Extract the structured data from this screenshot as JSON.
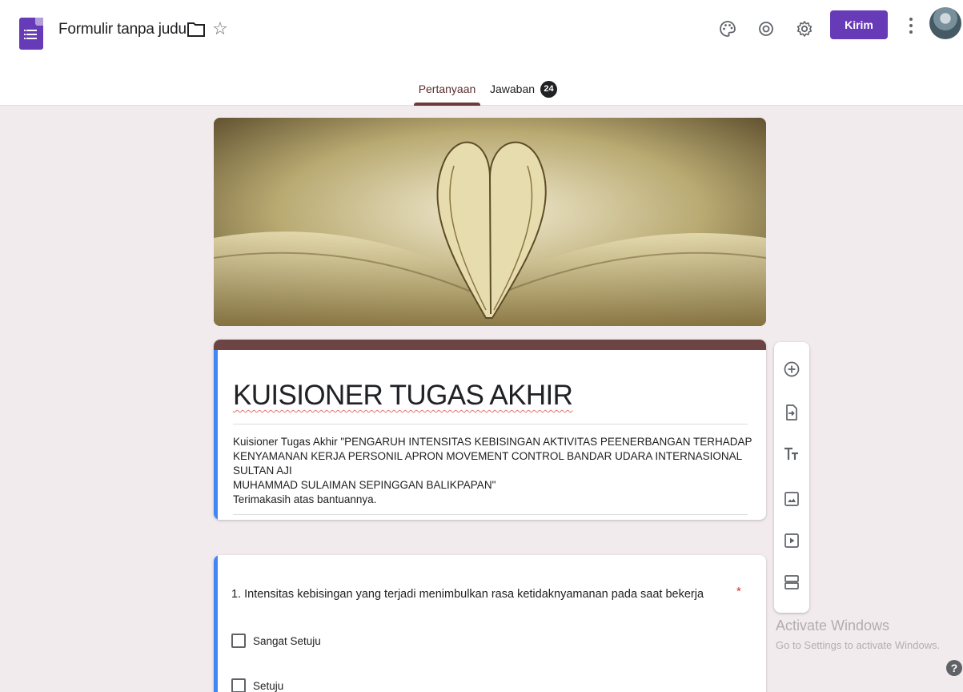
{
  "header": {
    "doc_title": "Formulir tanpa judul",
    "send_label": "Kirim"
  },
  "tabs": {
    "questions_label": "Pertanyaan",
    "responses_label": "Jawaban",
    "responses_count": "24"
  },
  "form": {
    "title": "KUISIONER TUGAS AKHIR",
    "description_line1": "Kuisioner Tugas Akhir \"PENGARUH INTENSITAS KEBISINGAN AKTIVITAS PEENERBANGAN TERHADAP",
    "description_line2": "KENYAMANAN KERJA PERSONIL APRON MOVEMENT CONTROL BANDAR UDARA INTERNASIONAL SULTAN AJI",
    "description_line3": "MUHAMMAD SULAIMAN SEPINGGAN BALIKPAPAN\"",
    "description_line4": "Terimakasih atas bantuannya."
  },
  "question": {
    "text": "1. Intensitas kebisingan yang terjadi menimbulkan rasa ketidaknyamanan pada saat bekerja",
    "required_mark": "*",
    "options": [
      "Sangat Setuju",
      "Setuju"
    ]
  },
  "watermark": {
    "line1": "Activate Windows",
    "line2": "Go to Settings to activate Windows."
  },
  "help_label": "?",
  "colors": {
    "brand": "#673ab7",
    "theme": "#6d4444",
    "accent_bar": "#4285f4",
    "page_bg": "#f1ebee"
  },
  "icons": [
    "forms-app-icon",
    "folder-icon",
    "star-icon",
    "palette-icon",
    "eye-icon",
    "gear-icon",
    "more-vert-icon",
    "add-circle-icon",
    "import-icon",
    "title-icon",
    "image-icon",
    "video-icon",
    "section-icon",
    "help-icon"
  ]
}
